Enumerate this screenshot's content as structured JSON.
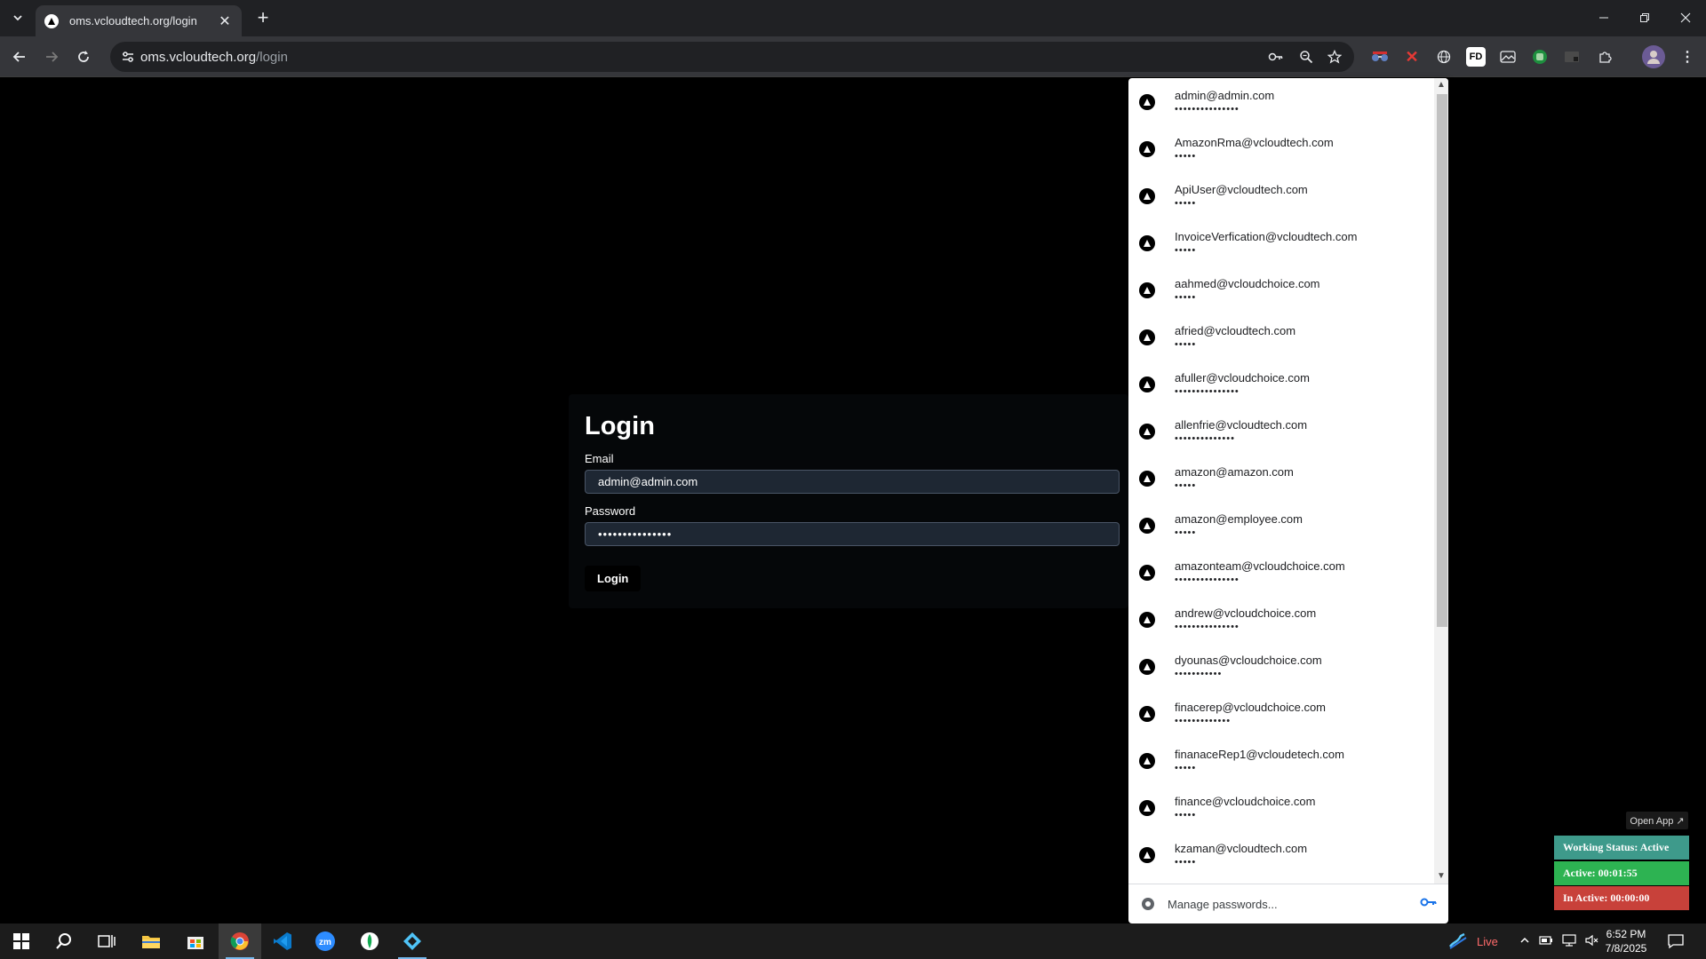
{
  "browser": {
    "tab_title": "oms.vcloudtech.org/login",
    "url_host": "oms.vcloudtech.org",
    "url_path": "/login"
  },
  "login": {
    "title": "Login",
    "email_label": "Email",
    "email_value": "admin@admin.com",
    "password_label": "Password",
    "password_value": "•••••••••••••••",
    "button": "Login"
  },
  "password_dropdown": {
    "items": [
      {
        "email": "admin@admin.com",
        "mask": "•••••••••••••••"
      },
      {
        "email": "AmazonRma@vcloudtech.com",
        "mask": "•••••"
      },
      {
        "email": "ApiUser@vcloudtech.com",
        "mask": "•••••"
      },
      {
        "email": "InvoiceVerfication@vcloudtech.com",
        "mask": "•••••"
      },
      {
        "email": "aahmed@vcloudchoice.com",
        "mask": "•••••"
      },
      {
        "email": "afried@vcloudtech.com",
        "mask": "•••••"
      },
      {
        "email": "afuller@vcloudchoice.com",
        "mask": "•••••••••••••••"
      },
      {
        "email": "allenfrie@vcloudtech.com",
        "mask": "••••••••••••••"
      },
      {
        "email": "amazon@amazon.com",
        "mask": "•••••"
      },
      {
        "email": "amazon@employee.com",
        "mask": "•••••"
      },
      {
        "email": "amazonteam@vcloudchoice.com",
        "mask": "•••••••••••••••"
      },
      {
        "email": "andrew@vcloudchoice.com",
        "mask": "•••••••••••••••"
      },
      {
        "email": "dyounas@vcloudchoice.com",
        "mask": "•••••••••••"
      },
      {
        "email": "finacerep@vcloudchoice.com",
        "mask": "•••••••••••••"
      },
      {
        "email": "finanaceRep1@vcloudetech.com",
        "mask": "•••••"
      },
      {
        "email": "finance@vcloudchoice.com",
        "mask": "•••••"
      },
      {
        "email": "kzaman@vcloudtech.com",
        "mask": "•••••"
      }
    ],
    "manage_label": "Manage passwords..."
  },
  "status_widget": {
    "open_app": "Open App ↗",
    "working_status": "Working Status: Active",
    "active": "Active: 00:01:55",
    "inactive": "In Active: 00:00:00"
  },
  "taskbar": {
    "live_label": "Live",
    "time": "6:52 PM",
    "date": "7/8/2025"
  }
}
